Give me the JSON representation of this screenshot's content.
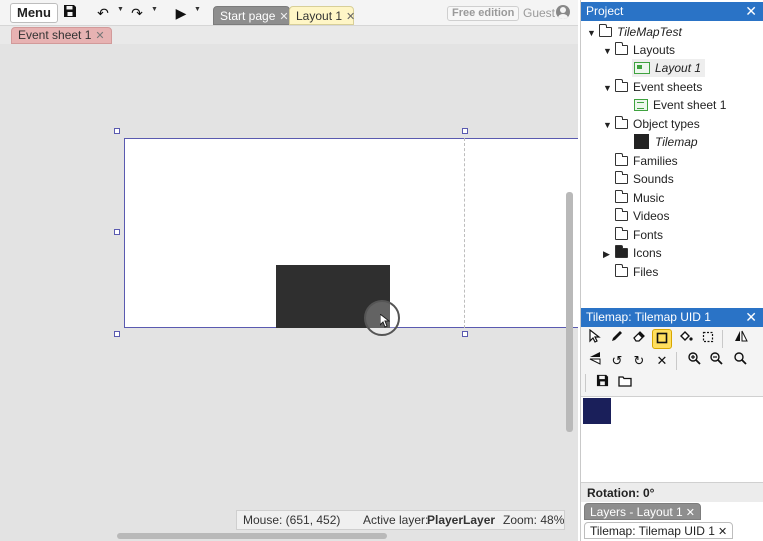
{
  "toolbar": {
    "menu_label": "Menu",
    "save_icon": "save-icon",
    "undo_icon": "undo-icon",
    "redo_icon": "redo-icon",
    "play_icon": "play-icon",
    "free_edition_label": "Free edition",
    "guest_label": "Guest"
  },
  "tabs": [
    {
      "label": "Start page",
      "close": "✕",
      "active": false
    },
    {
      "label": "Layout 1",
      "close": "✕",
      "active": true
    }
  ],
  "subtabs": [
    {
      "label": "Event sheet 1",
      "close": "✕"
    }
  ],
  "status_bar": {
    "mouse": "Mouse: (651, 452)",
    "active_layer_label": "Active layer:",
    "active_layer_value": "PlayerLayer",
    "zoom": "Zoom: 48%"
  },
  "project_panel": {
    "title": "Project",
    "close": "✕",
    "tree": {
      "root": "TileMapTest",
      "layouts_folder": "Layouts",
      "layout_item": "Layout 1",
      "event_sheets_folder": "Event sheets",
      "event_sheet_item": "Event sheet 1",
      "object_types_folder": "Object types",
      "object_item": "Tilemap",
      "families": "Families",
      "sounds": "Sounds",
      "music": "Music",
      "videos": "Videos",
      "fonts": "Fonts",
      "icons": "Icons",
      "files": "Files"
    }
  },
  "tilemap_panel": {
    "title": "Tilemap: Tilemap UID 1",
    "close": "✕",
    "rotation_label": "Rotation: 0°"
  },
  "bottom_tabs": [
    {
      "label": "Layers - Layout 1",
      "close": "✕"
    },
    {
      "label": "Tilemap: Tilemap UID 1",
      "close": "✕"
    }
  ],
  "colors": {
    "panel_header": "#2a73c6",
    "active_tool": "#ffdf5e",
    "layout_border": "#5a5ab0",
    "event_tab": "#e7b2b2",
    "layout_tab": "#fff6c6"
  }
}
